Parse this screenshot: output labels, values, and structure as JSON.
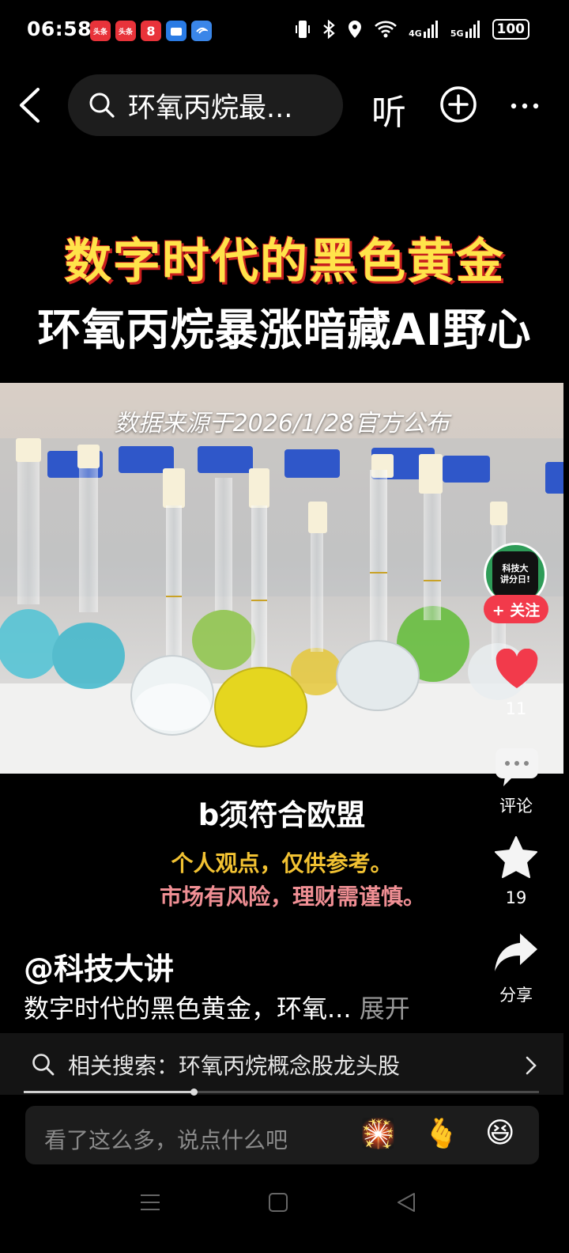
{
  "status_bar": {
    "time": "06:58",
    "apps": [
      {
        "icon": "toutiao-app-icon",
        "label": "头条",
        "color": "#e8333a"
      },
      {
        "icon": "toutiao-lite-app-icon",
        "label": "头条",
        "color": "#e8333a"
      },
      {
        "icon": "red-app-icon",
        "label": "8",
        "color": "#e8333a"
      },
      {
        "icon": "blue-folder-app-icon",
        "label": "",
        "color": "#2a7be4"
      },
      {
        "icon": "blue-swirl-app-icon",
        "label": "",
        "color": "#3a86e8"
      }
    ],
    "network_4g": "4G",
    "network_5g": "5G",
    "battery": "100"
  },
  "top_bar": {
    "search_text": "环氧丙烷最...",
    "listen_label": "听"
  },
  "video": {
    "headline_line1": "数字时代的黑色黄金",
    "headline_line2": "环氧丙烷暴涨暗藏AI野心",
    "source_caption": "数据来源于2026/1/28官方公布",
    "subtitle": "b须符合欧盟",
    "disclaimer_line1": "个人观点，仅供参考。",
    "disclaimer_line2": "市场有风险，理财需谨慎。"
  },
  "right_rail": {
    "avatar_text": "科技大\n讲分日!",
    "follow_label": "+ 关注",
    "like_count": "11",
    "comment_label": "评论",
    "favorite_count": "19",
    "share_label": "分享"
  },
  "author": {
    "name": "@科技大讲",
    "description": "数字时代的黑色黄金，环氧...",
    "expand_label": "展开"
  },
  "related_search": {
    "label": "相关搜索：环氧丙烷概念股龙头股"
  },
  "playback": {
    "progress": 0.33
  },
  "comment_input": {
    "placeholder": "看了这么多，说点什么吧",
    "emojis": [
      "🎇",
      "🫰",
      "😆"
    ]
  },
  "colors": {
    "headline_yellow": "#ffe34a",
    "follow_red": "#f23a4b",
    "like_red": "#f23a4b",
    "disclaimer_yellow": "#f2c232",
    "disclaimer_pink": "#f08f94"
  }
}
